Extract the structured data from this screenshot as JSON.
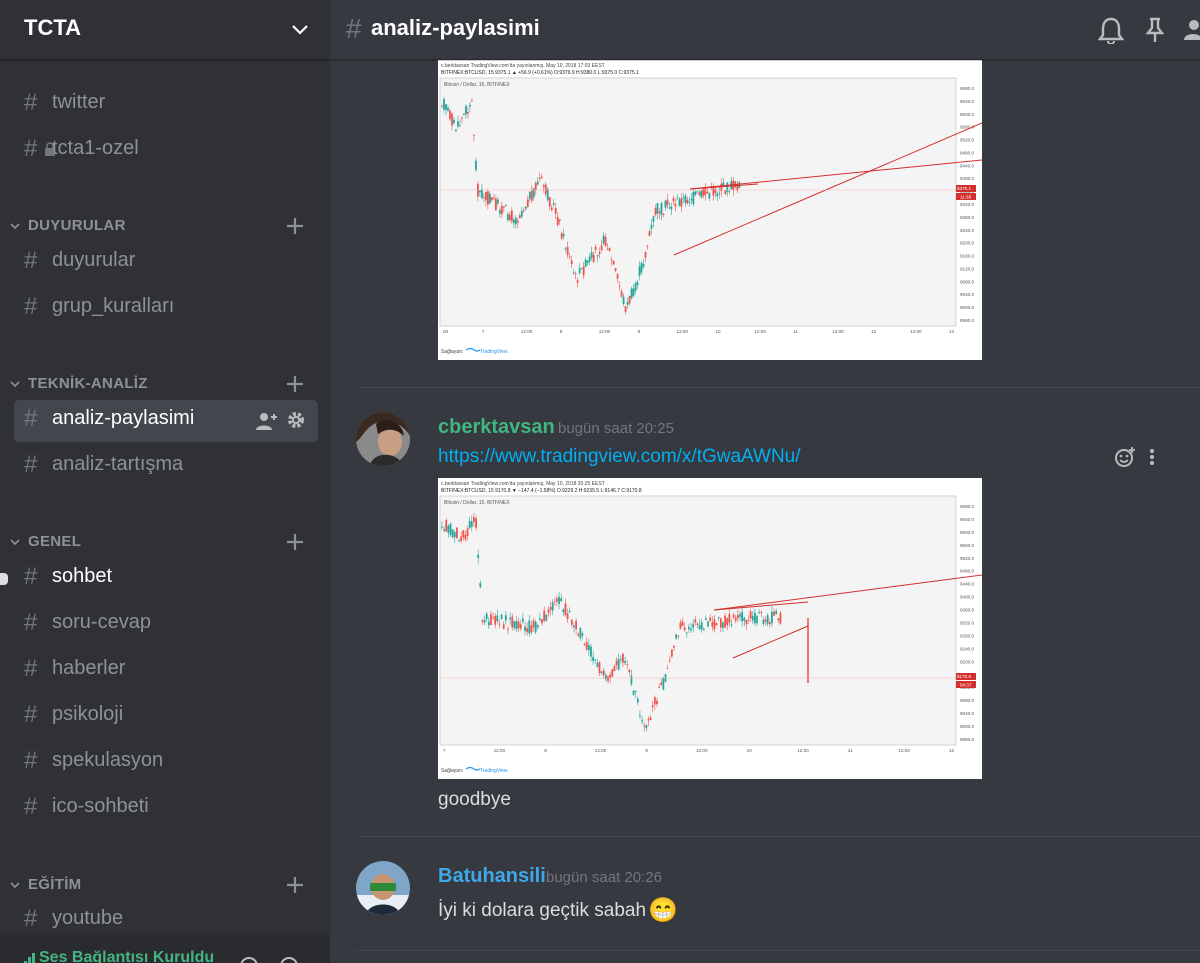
{
  "server": {
    "name": "TCTA"
  },
  "sidebar": {
    "channels_top": [
      {
        "label": "twitter"
      },
      {
        "label": "tcta1-ozel"
      }
    ],
    "categories": [
      {
        "name": "DUYURULAR",
        "channels": [
          {
            "label": "duyurular"
          },
          {
            "label": "grup_kuralları"
          }
        ]
      },
      {
        "name": "TEKNİK-ANALİZ",
        "channels": [
          {
            "label": "analiz-paylasimi"
          },
          {
            "label": "analiz-tartışma"
          }
        ]
      },
      {
        "name": "GENEL",
        "channels": [
          {
            "label": "sohbet"
          },
          {
            "label": "soru-cevap"
          },
          {
            "label": "haberler"
          },
          {
            "label": "psikoloji"
          },
          {
            "label": "spekulasyon"
          },
          {
            "label": "ico-sohbeti"
          }
        ]
      },
      {
        "name": "EĞİTİM",
        "channels": [
          {
            "label": "youtube"
          }
        ]
      }
    ],
    "voice_status": "Ses Bağlantısı Kuruldu"
  },
  "channel": {
    "title": "analiz-paylasimi"
  },
  "charts": [
    {
      "header_line1": "c.berktavsan TradingView.com'da yayınlanmış, May 10, 2018 17:03 EEST",
      "header_line2": "BITFINEX:BTCUSD, 15  9375.1 ▲ +56.9 (+0.61%) O:9379.9 H:9380.0 L:9375.0 C:9375.1",
      "symbol": "Bitcoin / Dollar, 15, BITFINEX",
      "price_tag": "9375.1",
      "time_tag": "11:38",
      "yticks": [
        "9680.0",
        "9640.0",
        "9600.0",
        "9560.0",
        "9520.0",
        "9480.0",
        "9440.0",
        "9400.0",
        "9360.0",
        "9320.0",
        "9280.0",
        "9240.0",
        "9200.0",
        "9160.0",
        "9120.0",
        "9080.0",
        "9040.0",
        "9000.0",
        "8960.0"
      ],
      "xticks": [
        "00",
        "7",
        "12:00",
        "8",
        "12:00",
        "9",
        "12:00",
        "10",
        "12:00",
        "11",
        "12:00",
        "12",
        "12:00",
        "13"
      ],
      "footer": "Sağlayan:",
      "brand": "TradingView"
    },
    {
      "header_line1": "c.berktavsan TradingView.com'da yayınlanmış, May 10, 2018 20:25 EEST",
      "header_line2": "BITFINEX:BTCUSD, 15  9170.8 ▼ −147.4 (−1.58%) O:9229.2 H:9235.5 L:9146.7 C:9170.8",
      "symbol": "Bitcoin / Dollar, 15, BITFINEX",
      "price_tag": "9170.8",
      "time_tag": "04:37",
      "yticks": [
        "9680.0",
        "9640.0",
        "9600.0",
        "9560.0",
        "9520.0",
        "9480.0",
        "9440.0",
        "9400.0",
        "9360.0",
        "9320.0",
        "9280.0",
        "9240.0",
        "9200.0",
        "9160.0",
        "9120.0",
        "9080.0",
        "9040.0",
        "9000.0",
        "8960.0"
      ],
      "xticks": [
        "7",
        "12:00",
        "8",
        "12:00",
        "9",
        "12:00",
        "10",
        "12:00",
        "11",
        "12:00",
        "12"
      ],
      "footer": "Sağlayan:",
      "brand": "TradingView"
    }
  ],
  "messages": [
    {
      "author": "cberktavsan",
      "author_color": "#43b581",
      "timestamp": "bugün saat 20:25",
      "link": "https://www.tradingview.com/x/tGwaAWNu/",
      "text": "goodbye"
    },
    {
      "author": "Batuhansili",
      "author_color": "#3ea8e8",
      "timestamp": "bugün saat 20:26",
      "text": "İyi ki dolara geçtik sabah",
      "emoji": "😁"
    }
  ],
  "colors": {
    "sidebar": "#2f3136",
    "main": "#36393f",
    "link": "#00b0f4",
    "online_green": "#43b581",
    "accent_red": "#d32f2f"
  }
}
